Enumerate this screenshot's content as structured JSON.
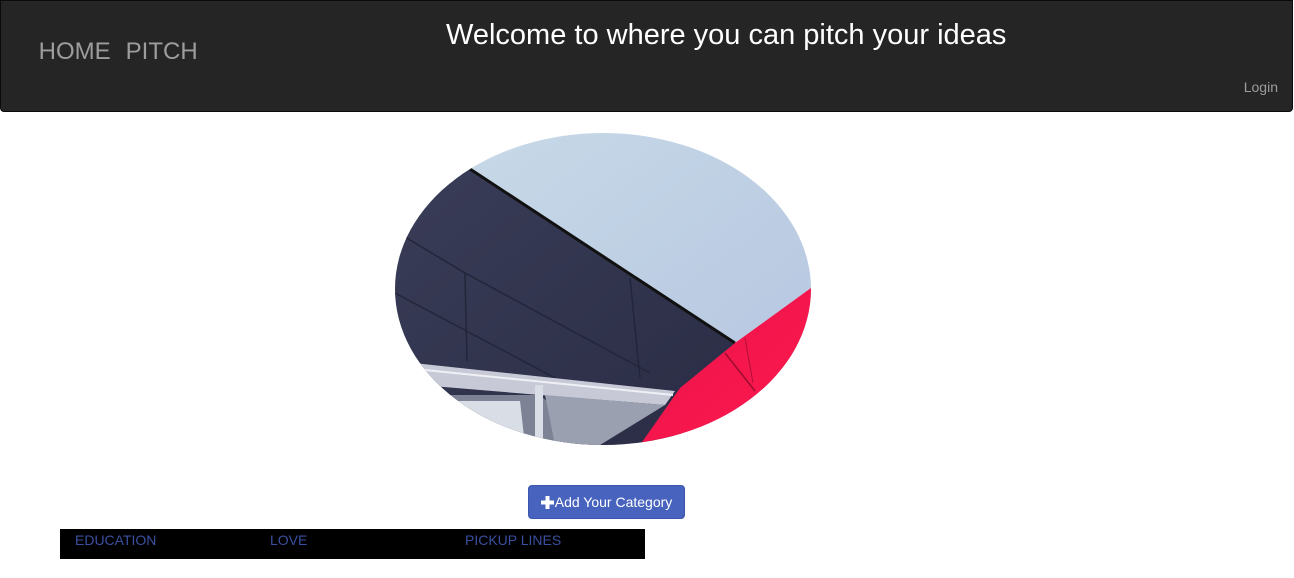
{
  "navbar": {
    "brand_items": [
      "HOME",
      "PITCH"
    ],
    "title": "Welcome to where you can pitch your ideas",
    "login_label": "Login"
  },
  "hero": {
    "image_description_icon": "building-photo"
  },
  "actions": {
    "add_category_label": "Add Your Category",
    "add_icon": "plus-icon"
  },
  "categories": [
    "EDUCATION",
    "LOVE",
    "PICKUP LINES"
  ],
  "colors": {
    "navbar_bg": "#252525",
    "button_bg": "#4763be",
    "category_bar_bg": "#000000",
    "category_link": "#3a4fa0"
  }
}
